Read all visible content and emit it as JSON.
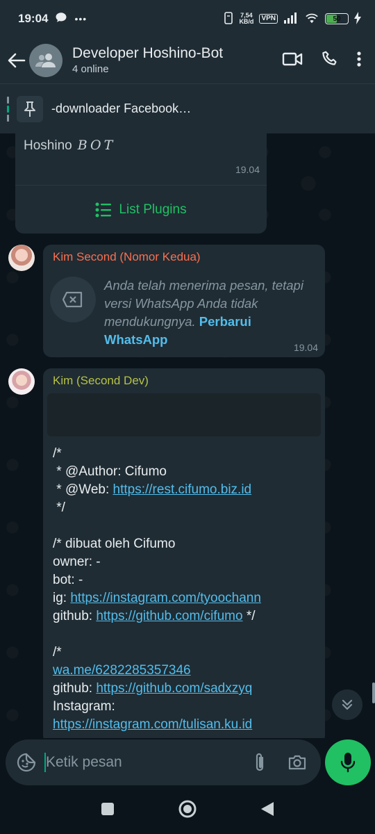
{
  "status_bar": {
    "time": "19:04",
    "more": "•••",
    "speed_value": "7,54",
    "speed_unit": "KB/d",
    "vpn": "VPN",
    "battery": "50"
  },
  "header": {
    "title": "Developer Hoshino-Bot",
    "subtitle": "4 online"
  },
  "pinned": {
    "text": "-downloader Facebook…"
  },
  "messages": {
    "first": {
      "signature_name": "Hoshino",
      "signature_bot": "BOT",
      "time": "19.04",
      "button_label": "List Plugins"
    },
    "second": {
      "sender": "Kim Second (Nomor Kedua)",
      "sender_color": "#fc6f4f",
      "text": "Anda telah menerima pesan, tetapi versi WhatsApp Anda tidak mendukungnya.",
      "link": "Perbarui WhatsApp",
      "time": "19.04"
    },
    "third": {
      "sender": "Kim (Second Dev)",
      "sender_color": "#b7c244",
      "lines": {
        "l1": "/*",
        "l2_prefix": " * @Author: Cifumo",
        "l3_prefix": " * @Web: ",
        "l3_link": "https://rest.cifumo.biz.id",
        "l4": " */",
        "l6": "/* dibuat oleh Cifumo",
        "l7": "owner: -",
        "l8": "bot: -",
        "l9_prefix": "ig: ",
        "l9_link": "https://instagram.com/tyoochann",
        "l10_prefix": "github: ",
        "l10_link": "https://github.com/cifumo",
        "l10_suffix": " */",
        "l12": "/*",
        "l13_link": "wa.me/6282285357346",
        "l14_prefix": "github: ",
        "l14_link": "https://github.com/sadxzyq",
        "l15_prefix": "Instagram: ",
        "l15_link": "https://instagram.com/tulisan.ku.id"
      }
    }
  },
  "input": {
    "placeholder": "Ketik pesan"
  },
  "colors": {
    "accent_green": "#21c063",
    "link_blue": "#53bdeb",
    "header_bg": "#1f2c34",
    "chat_bg": "#0b141a"
  }
}
